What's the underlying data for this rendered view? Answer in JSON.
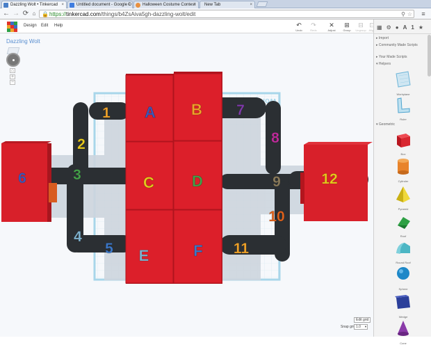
{
  "browser": {
    "tabs": [
      {
        "title": "Dazzling Wolt • Tinkercad",
        "favicon": "#4a7fc8",
        "active": true
      },
      {
        "title": "Untitled document - Google D",
        "favicon": "#3f7de0",
        "active": false
      },
      {
        "title": "Halloween Costume Contest",
        "favicon": "#e89040",
        "active": false
      },
      {
        "title": "New Tab",
        "favicon": "",
        "active": false
      }
    ],
    "url_scheme": "https://",
    "url_host": "tinkercad.com",
    "url_path": "/things/b4ZsAiva5gh-dazzling-wolt/edit"
  },
  "app": {
    "menu": [
      "Design",
      "Edit",
      "Help"
    ],
    "tools": [
      {
        "label": "Undo",
        "glyph": "↶",
        "enabled": true
      },
      {
        "label": "Redo",
        "glyph": "↷",
        "enabled": false
      },
      {
        "label": "Adjust",
        "glyph": "✕",
        "enabled": true
      },
      {
        "label": "Group",
        "glyph": "⊞",
        "enabled": true
      },
      {
        "label": "Ungroup",
        "glyph": "⊟",
        "enabled": false
      },
      {
        "label": "Align",
        "glyph": "⊡",
        "enabled": false
      }
    ],
    "design_name": "Dazzling Wolt",
    "workplane_label": "Workplane"
  },
  "blocks": [
    {
      "letter": "A",
      "color": "#3f58b8"
    },
    {
      "letter": "B",
      "color": "#f0a229"
    },
    {
      "letter": "C",
      "color": "#e8c91c"
    },
    {
      "letter": "D",
      "color": "#45a04a"
    },
    {
      "letter": "E",
      "color": "#7fb3d0"
    },
    {
      "letter": "F",
      "color": "#3c78c8"
    }
  ],
  "numbers": [
    {
      "n": "1",
      "color": "#f0a229"
    },
    {
      "n": "2",
      "color": "#e8c91c"
    },
    {
      "n": "3",
      "color": "#45a04a"
    },
    {
      "n": "4",
      "color": "#7fb3d0"
    },
    {
      "n": "5",
      "color": "#3c78c8"
    },
    {
      "n": "6",
      "color": "#3f58b8"
    },
    {
      "n": "7",
      "color": "#7e3aa8"
    },
    {
      "n": "8",
      "color": "#c02c9c"
    },
    {
      "n": "9",
      "color": "#8a7a5a"
    },
    {
      "n": "10",
      "color": "#e0621c"
    },
    {
      "n": "11",
      "color": "#f0a229"
    },
    {
      "n": "12",
      "color": "#e8c91c"
    }
  ],
  "sidebar": {
    "sections": [
      "Import",
      "Community Made Scripts",
      "Your Made Scripts",
      "Helpers",
      "Geometric"
    ],
    "helpers": [
      {
        "label": "Workplane",
        "icon": "workplane-icon"
      },
      {
        "label": "Ruler",
        "icon": "ruler-icon"
      }
    ],
    "shapes": [
      {
        "label": "Box",
        "icon": "box-icon",
        "color": "#d8262f"
      },
      {
        "label": "Cylinder",
        "icon": "cylinder-icon",
        "color": "#e8832a"
      },
      {
        "label": "Pyramid",
        "icon": "pyramid-icon",
        "color": "#e8cf1a"
      },
      {
        "label": "Roof",
        "icon": "roof-icon",
        "color": "#2ea044"
      },
      {
        "label": "Round Roof",
        "icon": "round-roof-icon",
        "color": "#4cb6c4"
      },
      {
        "label": "Sphere",
        "icon": "sphere-icon",
        "color": "#1e88c8"
      },
      {
        "label": "Wedge",
        "icon": "wedge-icon",
        "color": "#2b3f9a"
      },
      {
        "label": "Cone",
        "icon": "cone-icon",
        "color": "#8a3aa8"
      }
    ]
  },
  "grid": {
    "edit_grid": "Edit grid",
    "snap_label": "Snap grid",
    "snap_value": "1.0"
  }
}
